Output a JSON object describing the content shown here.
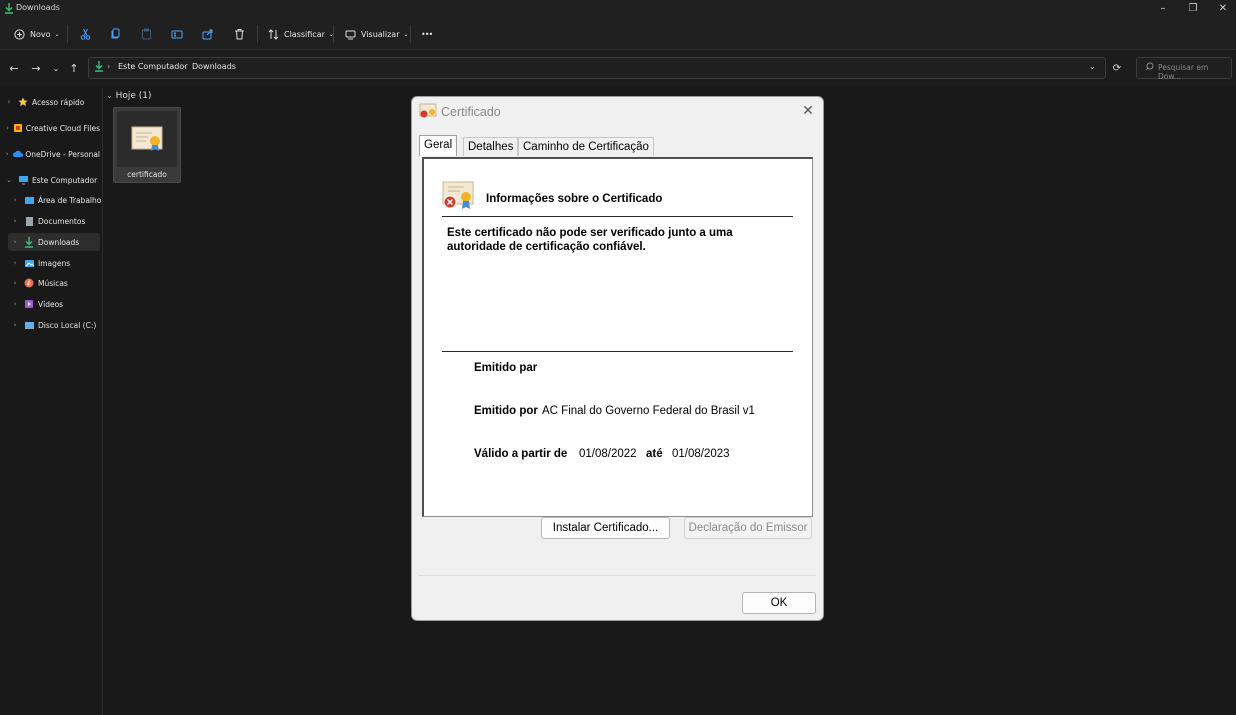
{
  "window": {
    "title": "Downloads",
    "controls": [
      "minimize",
      "restore",
      "close"
    ]
  },
  "toolbar": {
    "new_label": "Novo",
    "sort_label": "Classificar",
    "view_label": "Visualizar",
    "more_label": "•••"
  },
  "address": {
    "crumbs": [
      "Este Computador",
      "Downloads"
    ],
    "search_placeholder": "Pesquisar em Dow..."
  },
  "sidebar": {
    "items": [
      {
        "label": "Acesso rápido",
        "icon": "star-icon",
        "color": "#f6c744"
      },
      {
        "label": "Creative Cloud Files",
        "icon": "folder-icon",
        "color": "#f4b400"
      },
      {
        "label": "OneDrive - Personal",
        "icon": "cloud-icon",
        "color": "#2f8cf0"
      },
      {
        "label": "Este Computador",
        "icon": "monitor-icon",
        "color": "#3ba7f0"
      },
      {
        "label": "Área de Trabalho",
        "icon": "desktop-icon",
        "color": "#3ba7f0"
      },
      {
        "label": "Documentos",
        "icon": "document-icon",
        "color": "#9aa6b6"
      },
      {
        "label": "Downloads",
        "icon": "download-icon",
        "color": "#3cbf7a"
      },
      {
        "label": "Imagens",
        "icon": "image-icon",
        "color": "#3ba7f0"
      },
      {
        "label": "Músicas",
        "icon": "music-icon",
        "color": "#e9734f"
      },
      {
        "label": "Vídeos",
        "icon": "video-icon",
        "color": "#9b59d6"
      },
      {
        "label": "Disco Local (C:)",
        "icon": "drive-icon",
        "color": "#5fb0f0"
      }
    ]
  },
  "content": {
    "group_label": "Hoje (1)",
    "file": {
      "name": "certificado",
      "icon": "certificate-icon"
    }
  },
  "dialog": {
    "title": "Certificado",
    "tabs": [
      "Geral",
      "Detalhes",
      "Caminho de Certificação"
    ],
    "heading": "Informações sobre o Certificado",
    "warning_line1": "Este certificado não pode ser verificado junto a uma",
    "warning_line2": "autoridade de certificação confiável.",
    "issued_to_label": "Emitido par",
    "issued_by_label": "Emitido por",
    "issued_by_value": "AC Final do Governo Federal do Brasil v1",
    "valid_from_label": "Válido a partir de",
    "valid_from_value": "01/08/2022",
    "until_label": "até",
    "valid_to_value": "01/08/2023",
    "install_button": "Instalar Certificado...",
    "issuer_statement_button": "Declaração do Emissor",
    "ok_button": "OK"
  }
}
